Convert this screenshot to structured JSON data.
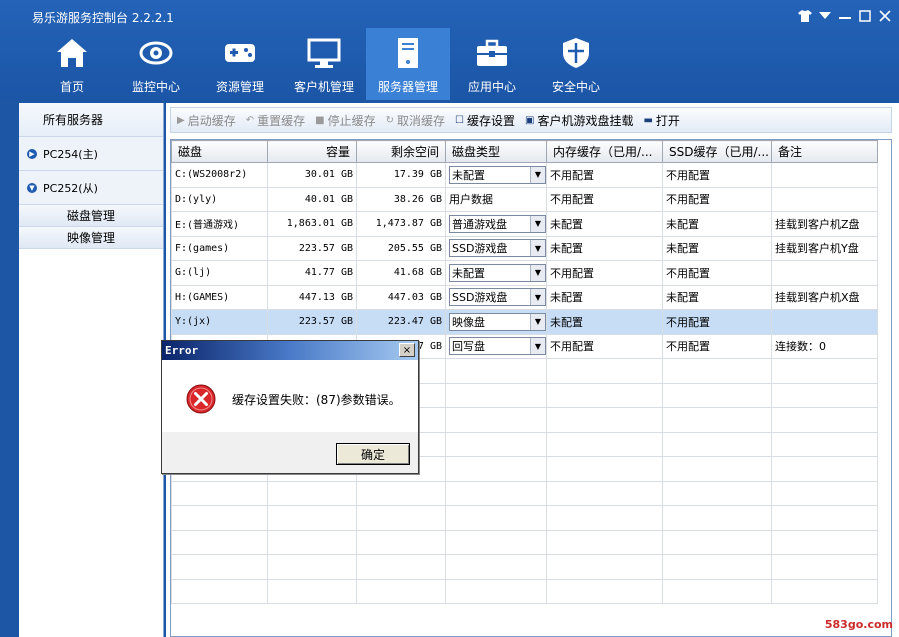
{
  "app": {
    "title": "易乐游服务控制台 2.2.2.1"
  },
  "window_controls": [
    "shirt-icon",
    "dropdown-icon",
    "minimize-icon",
    "maximize-icon",
    "close-icon"
  ],
  "nav": [
    {
      "label": "首页",
      "icon": "home-icon",
      "active": false
    },
    {
      "label": "监控中心",
      "icon": "eye-icon",
      "active": false
    },
    {
      "label": "资源管理",
      "icon": "gamepad-icon",
      "active": false
    },
    {
      "label": "客户机管理",
      "icon": "monitor-icon",
      "active": false
    },
    {
      "label": "服务器管理",
      "icon": "server-icon",
      "active": true
    },
    {
      "label": "应用中心",
      "icon": "toolbox-icon",
      "active": false
    },
    {
      "label": "安全中心",
      "icon": "shield-icon",
      "active": false
    }
  ],
  "sidebar": {
    "header": "所有服务器",
    "servers": [
      "PC254(主)",
      "PC252(从)"
    ],
    "sub_items": [
      "磁盘管理",
      "映像管理"
    ]
  },
  "toolbar": [
    {
      "label": "启动缓存",
      "icon": "play-icon",
      "enabled": false
    },
    {
      "label": "重置缓存",
      "icon": "reset-icon",
      "enabled": false
    },
    {
      "label": "停止缓存",
      "icon": "stop-icon",
      "enabled": false
    },
    {
      "label": "取消缓存",
      "icon": "refresh-icon",
      "enabled": false
    },
    {
      "label": "缓存设置",
      "icon": "checkbox-icon",
      "enabled": true
    },
    {
      "label": "客户机游戏盘挂载",
      "icon": "disk-icon",
      "enabled": true
    },
    {
      "label": "打开",
      "icon": "folder-icon",
      "enabled": true
    }
  ],
  "table": {
    "columns": [
      "磁盘",
      "容量",
      "剩余空间",
      "磁盘类型",
      "内存缓存（已用/...",
      "SSD缓存（已用/...",
      "备注"
    ],
    "rows": [
      {
        "disk": "C:(WS2008r2)",
        "capacity": "30.01 GB",
        "free": "17.39 GB",
        "type": "未配置",
        "combo": true,
        "mem": "不用配置",
        "ssd": "不用配置",
        "note": ""
      },
      {
        "disk": "D:(yly)",
        "capacity": "40.01 GB",
        "free": "38.26 GB",
        "type": "用户数据",
        "combo": false,
        "mem": "不用配置",
        "ssd": "不用配置",
        "note": ""
      },
      {
        "disk": "E:(普通游戏)",
        "capacity": "1,863.01 GB",
        "free": "1,473.87 GB",
        "type": "普通游戏盘",
        "combo": true,
        "mem": "未配置",
        "ssd": "未配置",
        "note": "挂载到客户机Z盘"
      },
      {
        "disk": "F:(games)",
        "capacity": "223.57 GB",
        "free": "205.55 GB",
        "type": "SSD游戏盘",
        "combo": true,
        "mem": "未配置",
        "ssd": "未配置",
        "note": "挂载到客户机Y盘"
      },
      {
        "disk": "G:(lj)",
        "capacity": "41.77 GB",
        "free": "41.68 GB",
        "type": "未配置",
        "combo": true,
        "mem": "不用配置",
        "ssd": "不用配置",
        "note": ""
      },
      {
        "disk": "H:(GAMES)",
        "capacity": "447.13 GB",
        "free": "447.03 GB",
        "type": "SSD游戏盘",
        "combo": true,
        "mem": "未配置",
        "ssd": "未配置",
        "note": "挂载到客户机X盘"
      },
      {
        "disk": "Y:(jx)",
        "capacity": "223.57 GB",
        "free": "223.47 GB",
        "type": "映像盘",
        "combo": true,
        "mem": "未配置",
        "ssd": "不用配置",
        "note": "",
        "selected": true
      },
      {
        "disk": "",
        "capacity": "",
        "free": "7 GB",
        "type": "回写盘",
        "combo": true,
        "mem": "不用配置",
        "ssd": "不用配置",
        "note": "连接数：0"
      }
    ],
    "empty_rows": 10
  },
  "dialog": {
    "title": "Error",
    "message": "缓存设置失败：(87)参数错误。",
    "ok_label": "确定",
    "close_glyph": "×"
  },
  "watermark": "583go.com"
}
